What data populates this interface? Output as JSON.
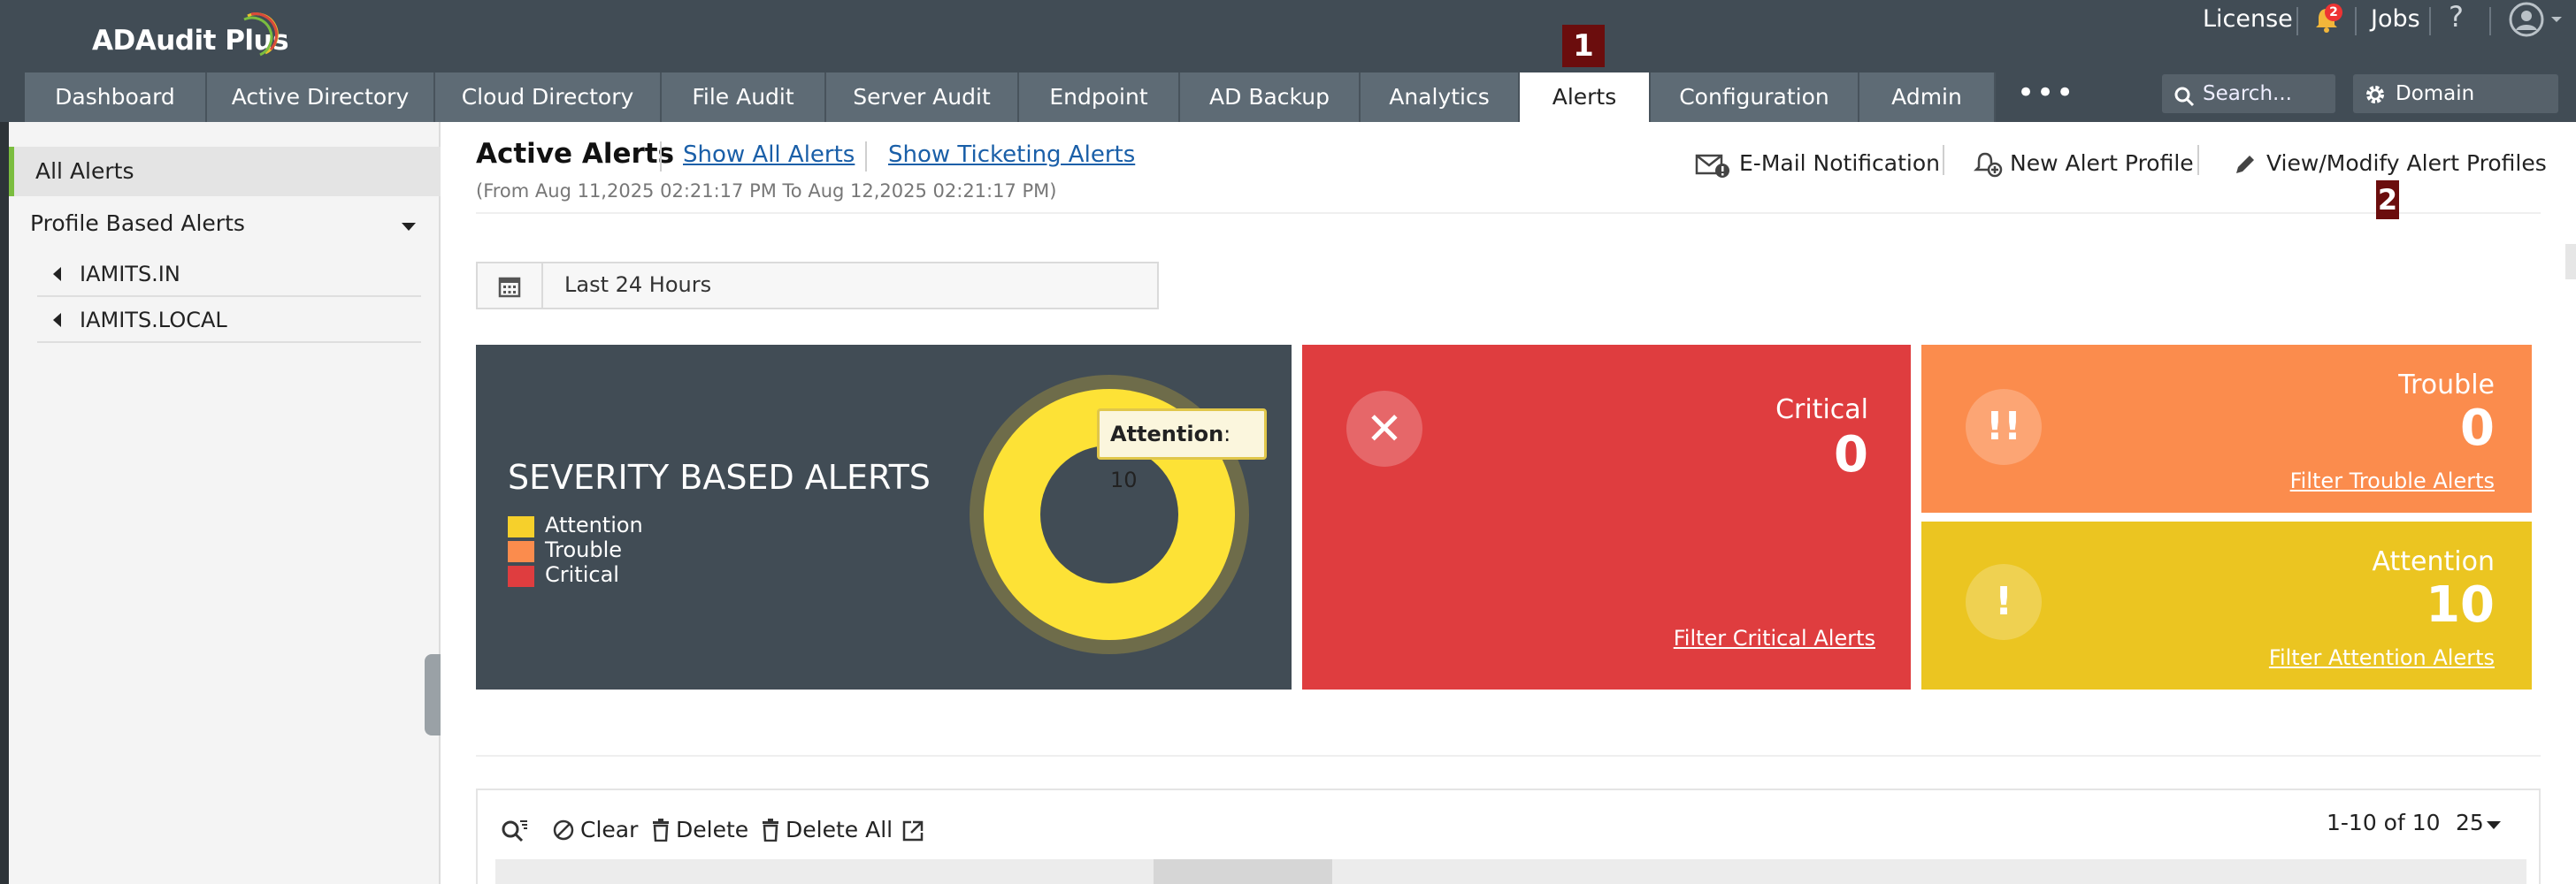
{
  "app": {
    "name": "ADAudit Plus"
  },
  "top_links": {
    "license": "License",
    "jobs": "Jobs",
    "help": "?",
    "notification_count": "2"
  },
  "nav_tabs": [
    {
      "label": "Dashboard"
    },
    {
      "label": "Active Directory"
    },
    {
      "label": "Cloud Directory"
    },
    {
      "label": "File Audit"
    },
    {
      "label": "Server Audit"
    },
    {
      "label": "Endpoint"
    },
    {
      "label": "AD Backup"
    },
    {
      "label": "Analytics"
    },
    {
      "label": "Alerts",
      "active": true
    },
    {
      "label": "Configuration"
    },
    {
      "label": "Admin"
    }
  ],
  "nav_more": "•••",
  "search": {
    "placeholder": "Search..."
  },
  "domain_settings": "Domain Settings",
  "callouts": {
    "one": "1",
    "two": "2"
  },
  "sidebar": {
    "all_alerts": "All Alerts",
    "profile_based": "Profile Based Alerts",
    "domains": [
      "IAMITS.IN",
      "IAMITS.LOCAL"
    ]
  },
  "header": {
    "title": "Active Alerts",
    "show_all": "Show All Alerts",
    "show_ticketing": "Show Ticketing Alerts",
    "date_range": "(From Aug 11,2025 02:21:17 PM To Aug 12,2025 02:21:17 PM)",
    "actions": {
      "email": "E-Mail Notification",
      "new_profile": "New Alert Profile",
      "modify": "View/Modify Alert Profiles"
    }
  },
  "period": {
    "value": "Last 24 Hours"
  },
  "severity": {
    "title": "SEVERITY BASED ALERTS",
    "legend": [
      {
        "label": "Attention",
        "color": "#f6d02b"
      },
      {
        "label": "Trouble",
        "color": "#fb8c4d"
      },
      {
        "label": "Critical",
        "color": "#df3d3f"
      }
    ],
    "tooltip_label": "Attention",
    "tooltip_value": ": 10",
    "donut_values": {
      "attention": 10,
      "trouble": 0,
      "critical": 0
    }
  },
  "cards": {
    "critical": {
      "label": "Critical",
      "count": "0",
      "filter": "Filter Critical Alerts",
      "icon": "✕"
    },
    "trouble": {
      "label": "Trouble",
      "count": "0",
      "filter": "Filter Trouble Alerts",
      "icon": "!!"
    },
    "attention": {
      "label": "Attention",
      "count": "10",
      "filter": "Filter Attention Alerts",
      "icon": "!"
    }
  },
  "toolbar": {
    "clear": "Clear",
    "delete": "Delete",
    "delete_all": "Delete All",
    "pager": "1-10 of 10",
    "page_size": "25"
  },
  "colors": {
    "topbar": "#414c55",
    "tab": "#5e6b75",
    "critical": "#df3d3f",
    "trouble": "#fb8c4d",
    "attention": "#ebc521",
    "link": "#1a5fa8"
  }
}
